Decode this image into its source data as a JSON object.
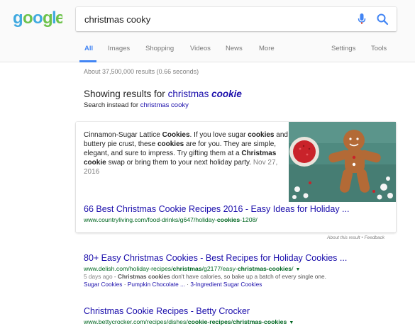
{
  "logo": {
    "text": "google",
    "alt": "google-logo"
  },
  "search": {
    "value": "christmas cooky"
  },
  "tabs": [
    {
      "label": "All",
      "active": true
    },
    {
      "label": "Images"
    },
    {
      "label": "Shopping"
    },
    {
      "label": "Videos"
    },
    {
      "label": "News"
    },
    {
      "label": "More"
    },
    {
      "label": "Settings"
    },
    {
      "label": "Tools"
    }
  ],
  "stats": "About 37,500,000 results (0.66 seconds)",
  "correction": {
    "showing_prefix": "Showing results for ",
    "corrected_plain": "christmas ",
    "corrected_bold": "cookie",
    "instead_prefix": "Search instead for ",
    "instead_query": "christmas cooky"
  },
  "featured": {
    "snippet_parts": [
      [
        "Cinnamon-Sugar Lattice ",
        false
      ],
      [
        "Cookies",
        true
      ],
      [
        ". If you love sugar ",
        false
      ],
      [
        "cookies",
        true
      ],
      [
        " and buttery pie crust, these ",
        false
      ],
      [
        "cookies",
        true
      ],
      [
        " are for you. They are simple, elegant, and sure to impress. Try gifting them at a ",
        false
      ],
      [
        "Christmas cookie",
        true
      ],
      [
        " swap or bring them to your next holiday party. ",
        false
      ]
    ],
    "date": "Nov 27, 2016",
    "title": "66 Best Christmas Cookie Recipes 2016 - Easy Ideas for Holiday ...",
    "url_prefix": "www.countryliving.com/food-drinks/g647/holiday-",
    "url_bold": "cookies",
    "url_suffix": "-1208/",
    "about": "About this result • Feedback"
  },
  "results": [
    {
      "title": "80+ Easy Christmas Cookies - Best Recipes for Holiday Cookies ...",
      "url_parts": [
        [
          "www.delish.com/holiday-recipes/",
          false
        ],
        [
          "christmas",
          true
        ],
        [
          "/g2177/easy-",
          false
        ],
        [
          "christmas-cookies",
          true
        ],
        [
          "/",
          false
        ]
      ],
      "snippet_date": "5 days ago",
      "snippet_parts": [
        [
          " - ",
          false
        ],
        [
          "Christmas cookies",
          true
        ],
        [
          " don't have calories, so bake up a batch of every single one.",
          false
        ]
      ],
      "sitelinks": [
        "Sugar Cookies",
        "Pumpkin Chocolate ...",
        "3-Ingredient Sugar Cookies"
      ]
    },
    {
      "title": "Christmas Cookie Recipes - Betty Crocker",
      "url_parts": [
        [
          "www.bettycrocker.com/recipes/dishes/",
          false
        ],
        [
          "cookie-recipes",
          true
        ],
        [
          "/",
          false
        ],
        [
          "christmas-cookies",
          true
        ]
      ]
    }
  ],
  "colors": {
    "link": "#1a0dab",
    "url": "#006621",
    "accent": "#4285f4",
    "logo_green": "#6cc24a",
    "logo_blue": "#3fa9e0"
  }
}
